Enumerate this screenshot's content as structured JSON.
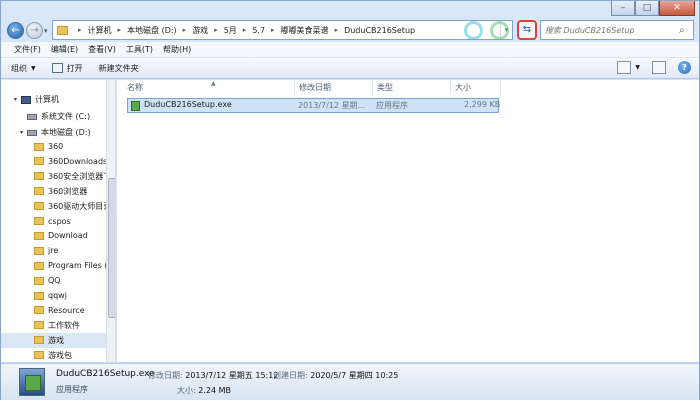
{
  "address": {
    "crumbs": [
      "计算机",
      "本地磁盘 (D:)",
      "游戏",
      "5月",
      "5.7",
      "嘟嘟美食菜谱",
      "DuduCB216Setup"
    ]
  },
  "search": {
    "placeholder": "搜索 DuduCB216Setup"
  },
  "menu": [
    "文件(F)",
    "编辑(E)",
    "查看(V)",
    "工具(T)",
    "帮助(H)"
  ],
  "commands": {
    "organize": "组织",
    "open": "打开",
    "new_folder": "新建文件夹"
  },
  "nav": {
    "items": [
      {
        "label": "计算机",
        "kind": "computer"
      },
      {
        "label": "系统文件 (C:)",
        "kind": "drive"
      },
      {
        "label": "本地磁盘 (D:)",
        "kind": "drive"
      },
      {
        "label": "360",
        "kind": "folder"
      },
      {
        "label": "360Downloads",
        "kind": "folder"
      },
      {
        "label": "360安全浏览器下",
        "kind": "folder"
      },
      {
        "label": "360浏览器",
        "kind": "folder"
      },
      {
        "label": "360驱动大师目录",
        "kind": "folder"
      },
      {
        "label": "cspos",
        "kind": "folder"
      },
      {
        "label": "Download",
        "kind": "folder"
      },
      {
        "label": "jre",
        "kind": "folder"
      },
      {
        "label": "Program Files (",
        "kind": "folder"
      },
      {
        "label": "QQ",
        "kind": "folder"
      },
      {
        "label": "qqwj",
        "kind": "folder"
      },
      {
        "label": "Resource",
        "kind": "folder"
      },
      {
        "label": "工作软件",
        "kind": "folder"
      },
      {
        "label": "游戏",
        "kind": "folder",
        "selected": true
      },
      {
        "label": "游戏包",
        "kind": "folder"
      }
    ]
  },
  "columns": {
    "name": "名称",
    "date": "修改日期",
    "type": "类型",
    "size": "大小"
  },
  "files": [
    {
      "name": "DuduCB216Setup.exe",
      "date": "2013/7/12 星期...",
      "type": "应用程序",
      "size": "2,299 KB"
    }
  ],
  "details": {
    "name": "DuduCB216Setup.exe",
    "type": "应用程序",
    "modified_label": "修改日期:",
    "modified": "2013/7/12 星期五 15:12",
    "created_label": "创建日期:",
    "created": "2020/5/7 星期四 10:25",
    "size_label": "大小:",
    "size": "2.24 MB"
  }
}
